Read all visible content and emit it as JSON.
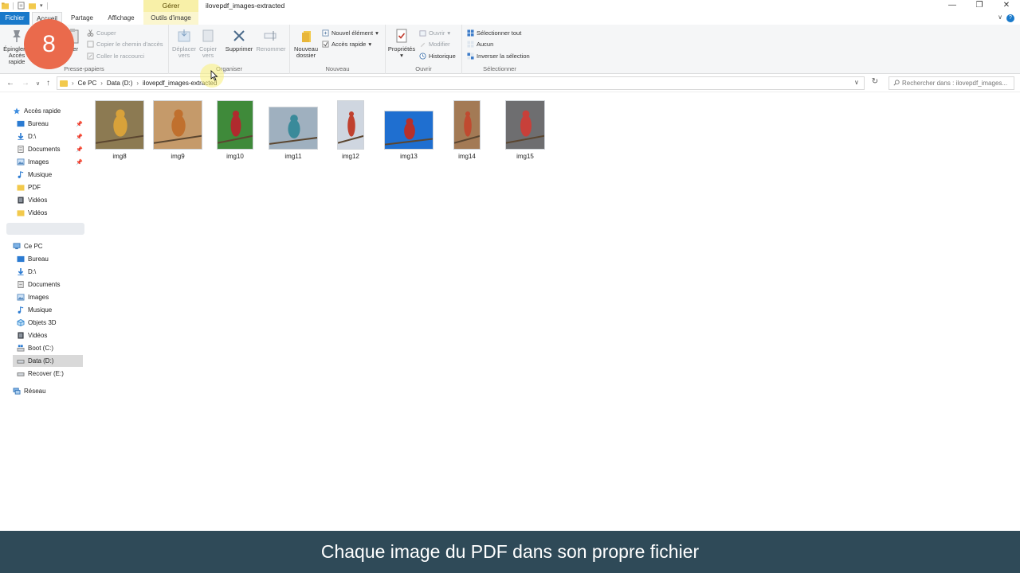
{
  "titlebar": {
    "context_tab": "Gérer",
    "window_title": "ilovepdf_images-extracted",
    "minimize": "—",
    "maximize": "❐",
    "close": "✕"
  },
  "tabs": {
    "fichier": "Fichier",
    "accueil": "Accueil",
    "partage": "Partage",
    "affichage": "Affichage",
    "outils_image": "Outils d'image"
  },
  "ribbon": {
    "presse_papiers": {
      "label": "Presse-papiers",
      "epingler": "Épingler à",
      "acces_rapide": "Accès rapide",
      "coller": "oller",
      "couper": "Couper",
      "copier_chemin": "Copier le chemin d'accès",
      "coller_raccourci": "Coller le raccourci"
    },
    "organiser": {
      "label": "Organiser",
      "deplacer": "Déplacer",
      "deplacer2": "vers",
      "copier": "Copier",
      "copier2": "vers",
      "supprimer": "Supprimer",
      "renommer": "Renommer"
    },
    "nouveau": {
      "label": "Nouveau",
      "nouveau_dossier": "Nouveau",
      "nouveau_dossier2": "dossier",
      "nouvel_element": "Nouvel élément",
      "acces_rapide": "Accès rapide"
    },
    "ouvrir": {
      "label": "Ouvrir",
      "proprietes": "Propriétés",
      "ouvrir": "Ouvrir",
      "modifier": "Modifier",
      "historique": "Historique"
    },
    "selectionner": {
      "label": "Sélectionner",
      "tout": "Sélectionner tout",
      "aucun": "Aucun",
      "inverser": "Inverser la sélection"
    }
  },
  "address": {
    "crumbs": [
      "Ce PC",
      "Data (D:)",
      "ilovepdf_images-extracted"
    ],
    "search_placeholder": "Rechercher dans : ilovepdf_images..."
  },
  "nav": {
    "quick_access": "Accès rapide",
    "quick_items": [
      "Bureau",
      "D:\\",
      "Documents",
      "Images",
      "Musique",
      "PDF",
      "Vidéos",
      "Vidéos"
    ],
    "this_pc": "Ce PC",
    "pc_items": [
      "Bureau",
      "D:\\",
      "Documents",
      "Images",
      "Musique",
      "Objets 3D",
      "Vidéos",
      "Boot (C:)",
      "Data (D:)",
      "Recover (E:)"
    ],
    "network": "Réseau"
  },
  "files": [
    {
      "name": "img8",
      "bg": "#8c7a52",
      "bird": "#d8a23a"
    },
    {
      "name": "img9",
      "bg": "#c59a6a",
      "bird": "#c0702e"
    },
    {
      "name": "img10",
      "bg": "#3f8a3a",
      "bird": "#b02a2e"
    },
    {
      "name": "img11",
      "bg": "#9fb0bf",
      "bird": "#3a8a9a"
    },
    {
      "name": "img12",
      "bg": "#cfd6e0",
      "bird": "#c0402e"
    },
    {
      "name": "img13",
      "bg": "#1f6fd0",
      "bird": "#b8302a"
    },
    {
      "name": "img14",
      "bg": "#a37a55",
      "bird": "#c04a30"
    },
    {
      "name": "img15",
      "bg": "#6e6e70",
      "bird": "#c8403a"
    }
  ],
  "step_badge": "8",
  "caption": "Chaque image du PDF dans son propre fichier",
  "colors": {
    "accent": "#1979ca",
    "badge": "#ea6a4c",
    "caption_bg": "#2f4a58",
    "context_tab": "#f8f0a8"
  }
}
